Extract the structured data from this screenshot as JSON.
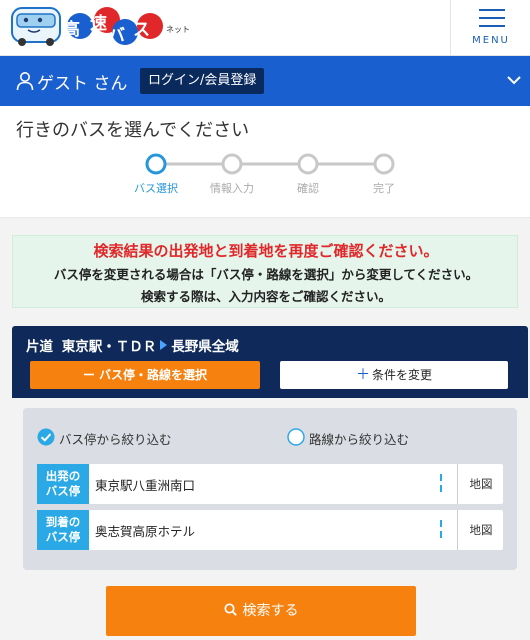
{
  "header": {
    "logo_text_1": "高",
    "logo_text_2": "速",
    "logo_text_3": "バ",
    "logo_text_4": "ス",
    "logo_suffix": "ネット",
    "menu_label": "MENU"
  },
  "userbar": {
    "user_name": "ゲスト さん",
    "login_label": "ログイン/会員登録",
    "icon": "user-icon"
  },
  "steps": {
    "title": "行きのバスを選んでください",
    "items": [
      {
        "label": "バス選択",
        "active": true
      },
      {
        "label": "情報入力",
        "active": false
      },
      {
        "label": "確認",
        "active": false
      },
      {
        "label": "完了",
        "active": false
      }
    ]
  },
  "notice": {
    "title": "検索結果の出発地と到着地を再度ご確認ください。",
    "line1": "バス停を変更される場合は「バス停・路線を選択」から変更してください。",
    "line2": "検索する際は、入力内容をご確認ください。"
  },
  "route": {
    "trip_type": "片道",
    "from": "東京駅・ＴＤＲ",
    "to": "長野県全域",
    "select_button": "バス停・路線を選択",
    "select_prefix": "ー",
    "change_button": "条件を変更",
    "change_prefix": "＋"
  },
  "filter": {
    "radio_bus_stop": "バス停から絞り込む",
    "radio_route": "路線から絞り込む",
    "departure_tag_1": "出発の",
    "departure_tag_2": "バス停",
    "departure_value": "東京駅八重洲南口",
    "arrival_tag_1": "到着の",
    "arrival_tag_2": "バス停",
    "arrival_value": "奥志賀高原ホテル",
    "map_label": "地図"
  },
  "search": {
    "label": "検索する"
  },
  "colors": {
    "primary_blue": "#1a5fd0",
    "navy": "#0f2a5a",
    "orange": "#f7810f",
    "accent_cyan": "#2ba9e6",
    "step_active": "#2796db",
    "alert_red": "#e0282a"
  }
}
